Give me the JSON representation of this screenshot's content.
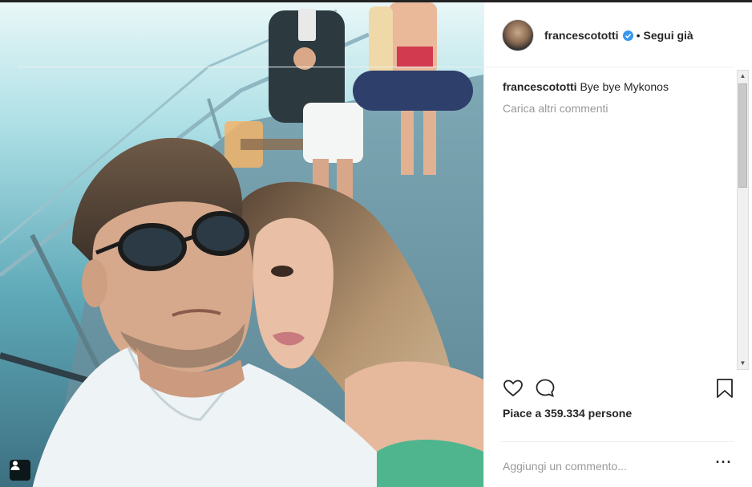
{
  "post": {
    "username": "francescototti",
    "follow_separator": "•",
    "follow_label": "Segui già",
    "caption_user": "francescototti",
    "caption_text": "Bye bye Mykonos",
    "load_more_label": "Carica altri commenti",
    "likes_prefix": "Piace a",
    "likes_count": "359.334",
    "likes_suffix": "persone",
    "comment_placeholder": "Aggiungi un commento...",
    "more_label": "···"
  },
  "icons": {
    "verified": "verified-badge-icon",
    "like": "heart-icon",
    "comment": "comment-bubble-icon",
    "save": "bookmark-icon",
    "user_tag": "user-tag-icon"
  },
  "colors": {
    "text": "#262626",
    "muted": "#999999",
    "verified": "#3897f0",
    "divider": "#efefef"
  }
}
